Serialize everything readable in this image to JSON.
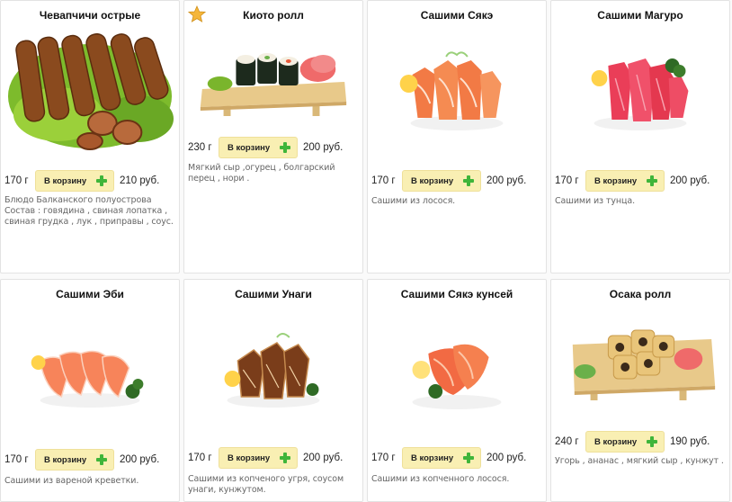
{
  "common": {
    "cart_label": "В корзину"
  },
  "products": [
    {
      "title": "Чевапчичи острые",
      "weight": "170 г",
      "price": "210 руб.",
      "desc": "Блюдо Балканского полуострова Состав : говядина , свиная лопатка , свиная грудка , лук , приправы , соус.",
      "featured": false,
      "image": "kebab-photo"
    },
    {
      "title": "Киото ролл",
      "weight": "230 г",
      "price": "200 руб.",
      "desc": "Мягкий сыр ,огурец , болгарский перец , нори .",
      "featured": true,
      "image": "roll-photo"
    },
    {
      "title": "Сашими Сякэ",
      "weight": "170 г",
      "price": "200 руб.",
      "desc": "Сашими из лосося.",
      "featured": false,
      "image": "salmon-sashimi-photo"
    },
    {
      "title": "Сашими Магуро",
      "weight": "170 г",
      "price": "200 руб.",
      "desc": "Сашими из тунца.",
      "featured": false,
      "image": "tuna-sashimi-photo"
    },
    {
      "title": "Сашими Эби",
      "weight": "170 г",
      "price": "200 руб.",
      "desc": "Сашими из вареной креветки.",
      "featured": false,
      "image": "shrimp-sashimi-photo"
    },
    {
      "title": "Сашими Унаги",
      "weight": "170 г",
      "price": "200 руб.",
      "desc": "Сашими из копченого угря, соусом унаги, кунжутом.",
      "featured": false,
      "image": "eel-sashimi-photo"
    },
    {
      "title": "Сашими Сякэ кунсей",
      "weight": "170 г",
      "price": "200 руб.",
      "desc": "Сашими из копченного лосося.",
      "featured": false,
      "image": "smoked-salmon-photo"
    },
    {
      "title": "Осака ролл",
      "weight": "240 г",
      "price": "190 руб.",
      "desc": "Угорь , ананас , мягкий сыр , кунжут .",
      "featured": false,
      "image": "osaka-roll-photo"
    }
  ]
}
